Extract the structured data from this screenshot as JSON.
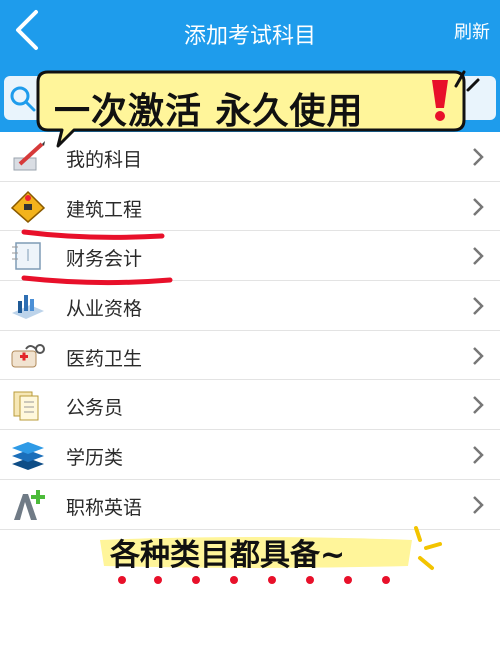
{
  "header": {
    "title": "添加考试科目",
    "refresh_label": "刷新"
  },
  "items": [
    {
      "label": "我的科目",
      "icon": "pencil-doc-icon"
    },
    {
      "label": "建筑工程",
      "icon": "construction-sign-icon"
    },
    {
      "label": "财务会计",
      "icon": "ledger-book-icon"
    },
    {
      "label": "从业资格",
      "icon": "certificate-stack-icon"
    },
    {
      "label": "医药卫生",
      "icon": "medical-kit-icon"
    },
    {
      "label": "公务员",
      "icon": "documents-icon"
    },
    {
      "label": "学历类",
      "icon": "layers-icon"
    },
    {
      "label": "职称英语",
      "icon": "letter-a-plus-icon"
    }
  ],
  "overlays": {
    "top_banner": "一次激活 永久使用",
    "bottom_banner": "各种类目都具备~"
  },
  "colors": {
    "header": "#1e9cec",
    "highlight": "#fff59a",
    "marker": "#e8102a"
  }
}
